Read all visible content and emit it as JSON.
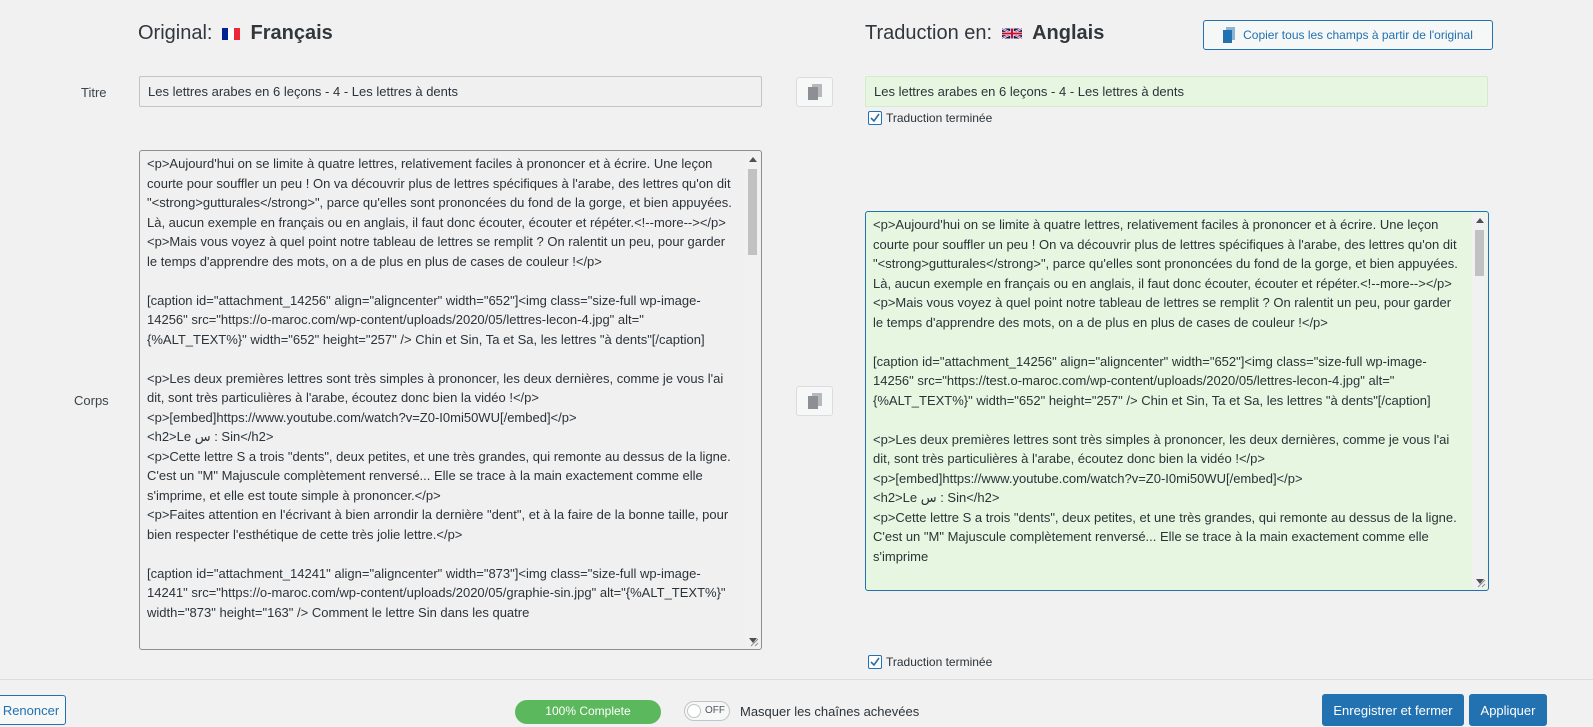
{
  "header": {
    "original_prefix": "Original:",
    "original_lang": "Français",
    "translation_prefix": "Traduction en:",
    "translation_lang": "Anglais",
    "copy_all_label": "Copier tous les champs à partir de l'original"
  },
  "title_row": {
    "label": "Titre",
    "original": "Les lettres arabes en 6 leçons - 4 - Les lettres à dents",
    "translation": "Les lettres arabes en 6 leçons - 4 - Les lettres à dents",
    "done_label": "Traduction terminée"
  },
  "body_row": {
    "label": "Corps",
    "original": "<p>Aujourd'hui on se limite à quatre lettres, relativement faciles à prononcer et à écrire. Une leçon courte pour souffler un peu ! On va découvrir plus de lettres spécifiques à l'arabe, des lettres qu'on dit \"<strong>gutturales</strong>\", parce qu'elles sont prononcées du fond de la gorge, et bien appuyées. Là, aucun exemple en français ou en anglais, il faut donc écouter, écouter et répéter.<!--more--></p>\n<p>Mais vous voyez à quel point notre tableau de lettres se remplit ? On ralentit un peu, pour garder le temps d'apprendre des mots, on a de plus en plus de cases de couleur !</p>\n\n[caption id=\"attachment_14256\" align=\"aligncenter\" width=\"652\"]<img class=\"size-full wp-image-14256\" src=\"https://o-maroc.com/wp-content/uploads/2020/05/lettres-lecon-4.jpg\" alt=\"{%ALT_TEXT%}\" width=\"652\" height=\"257\" /> Chin et Sin, Ta et Sa, les lettres \"à dents\"[/caption]\n\n<p>Les deux premières lettres sont très simples à prononcer, les deux dernières, comme je vous l'ai dit, sont très particulières à l'arabe, écoutez donc bien la vidéo !</p>\n<p>[embed]https://www.youtube.com/watch?v=Z0-I0mi50WU[/embed]</p>\n<h2>Le س : Sin</h2>\n<p>Cette lettre S a trois \"dents\", deux petites, et une très grandes, qui remonte au dessus de la ligne. C'est un \"M\" Majuscule complètement renversé... Elle se trace à la main exactement comme elle s'imprime, et elle est toute simple à prononcer.</p>\n<p>Faites attention en l'écrivant à bien arrondir la dernière \"dent\", et à la faire de la bonne taille, pour bien respecter l'esthétique de cette très jolie lettre.</p>\n\n[caption id=\"attachment_14241\" align=\"aligncenter\" width=\"873\"]<img class=\"size-full wp-image-14241\" src=\"https://o-maroc.com/wp-content/uploads/2020/05/graphie-sin.jpg\" alt=\"{%ALT_TEXT%}\" width=\"873\" height=\"163\" /> Comment le lettre Sin dans les quatre",
    "translation": "<p>Aujourd'hui on se limite à quatre lettres, relativement faciles à prononcer et à écrire. Une leçon courte pour souffler un peu ! On va découvrir plus de lettres spécifiques à l'arabe, des lettres qu'on dit \"<strong>gutturales</strong>\", parce qu'elles sont prononcées du fond de la gorge, et bien appuyées. Là, aucun exemple en français ou en anglais, il faut donc écouter, écouter et répéter.<!--more--></p>\n<p>Mais vous voyez à quel point notre tableau de lettres se remplit ? On ralentit un peu, pour garder le temps d'apprendre des mots, on a de plus en plus de cases de couleur !</p>\n\n[caption id=\"attachment_14256\" align=\"aligncenter\" width=\"652\"]<img class=\"size-full wp-image-14256\" src=\"https://test.o-maroc.com/wp-content/uploads/2020/05/lettres-lecon-4.jpg\" alt=\"{%ALT_TEXT%}\" width=\"652\" height=\"257\" /> Chin et Sin, Ta et Sa, les lettres \"à dents\"[/caption]\n\n<p>Les deux premières lettres sont très simples à prononcer, les deux dernières, comme je vous l'ai dit, sont très particulières à l'arabe, écoutez donc bien la vidéo !</p>\n<p>[embed]https://www.youtube.com/watch?v=Z0-I0mi50WU[/embed]</p>\n<h2>Le س : Sin</h2>\n<p>Cette lettre S a trois \"dents\", deux petites, et une très grandes, qui remonte au dessus de la ligne. C'est un \"M\" Majuscule complètement renversé... Elle se trace à la main exactement comme elle s'imprime",
    "done_label": "Traduction terminée"
  },
  "footer": {
    "cancel_label": "Renoncer",
    "progress_label": "100% Complete",
    "progress_value": 100,
    "toggle_state": "OFF",
    "hide_completed_label": "Masquer les chaînes achevées",
    "save_close_label": "Enregistrer et fermer",
    "apply_label": "Appliquer"
  },
  "colors": {
    "primary": "#2271b1",
    "translation_bg": "#e6f6e1",
    "original_bg": "#f0f0f1",
    "progress_green": "#5cb85c"
  }
}
